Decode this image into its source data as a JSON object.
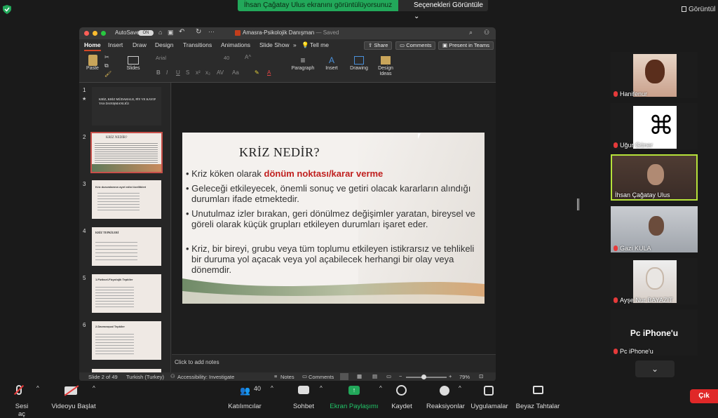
{
  "zoom": {
    "share_banner": "İhsan Çağatay Ulus ekranını görüntülüyorsunuz",
    "options_button": "Seçenekleri Görüntüle",
    "view_button": "Görüntül",
    "leave_button": "Çık"
  },
  "ppt": {
    "autosave_label": "AutoSave",
    "autosave_state": "ON",
    "doc_title": "Amasra-Psikolojik Danışman",
    "doc_saved": "— Saved",
    "tabs": [
      "Home",
      "Insert",
      "Draw",
      "Design",
      "Transitions",
      "Animations",
      "Slide Show",
      "Tell me"
    ],
    "share": "Share",
    "comments": "Comments",
    "present_teams": "Present in Teams",
    "ribbon": {
      "paste": "Paste",
      "slides": "Slides",
      "font": "Arial",
      "font_size": "40",
      "paragraph": "Paragraph",
      "insert": "Insert",
      "drawing": "Drawing",
      "design_ideas": "Design Ideas"
    },
    "thumbnails": [
      {
        "num": "1",
        "title": "KRİZ, KRİZ MÜDAHALE, PİY VE KAYIP YAS DANIŞMANLIĞI"
      },
      {
        "num": "2",
        "title": "KRİZ NEDİR?"
      },
      {
        "num": "3",
        "title": "Kriz durumlarının ayırt edici özellikleri"
      },
      {
        "num": "4",
        "title": "KRİZ TEPKİLERİ"
      },
      {
        "num": "5",
        "title": "1.Fiziksel-Fizyolojik Tepkiler"
      },
      {
        "num": "6",
        "title": "2.Davranışsal Tepkiler"
      }
    ],
    "slide": {
      "title": "KRİZ NEDİR?",
      "bullet1_pre": "Kriz köken olarak ",
      "bullet1_bold": "dönüm noktası/karar verme",
      "bullet2": "Geleceği etkileyecek, önemli sonuç ve getiri olacak kararların alındığı durumları ifade etmektedir.",
      "bullet3": "Unutulmaz izler bırakan, geri dönülmez değişimler yaratan, bireysel ve göreli olarak küçük grupları etkileyen durumları işaret eder.",
      "bullet4": "Kriz, bir bireyi, grubu veya tüm toplumu etkileyen istikrarsız ve tehlikeli bir duruma yol açacak veya yol açabilecek herhangi bir olay veya dönemdir."
    },
    "notes_placeholder": "Click to add notes",
    "status": {
      "slide_info": "Slide 2 of 49",
      "language": "Turkish (Turkey)",
      "accessibility": "Accessibility: Investigate",
      "notes": "Notes",
      "comments": "Comments",
      "zoom": "79%"
    }
  },
  "participants": [
    {
      "name": "Hanifenur",
      "muted": true
    },
    {
      "name": "Uğur Güner",
      "muted": true
    },
    {
      "name": "İhsan Çağatay Ulus",
      "muted": false
    },
    {
      "name": "Gazi KULA",
      "muted": true
    },
    {
      "name": "Ayşe Nur BAYAZIT",
      "muted": true
    },
    {
      "name": "Pc iPhone'u",
      "muted": true,
      "center_label": "Pc iPhone'u"
    }
  ],
  "toolbar": {
    "mute": "Sesi aç",
    "video": "Videoyu Başlat",
    "participants": "Katılımcılar",
    "participants_count": "40",
    "chat": "Sohbet",
    "share": "Ekran Paylaşımı",
    "record": "Kaydet",
    "reactions": "Reaksiyonlar",
    "apps": "Uygulamalar",
    "whiteboards": "Beyaz Tahtalar"
  }
}
